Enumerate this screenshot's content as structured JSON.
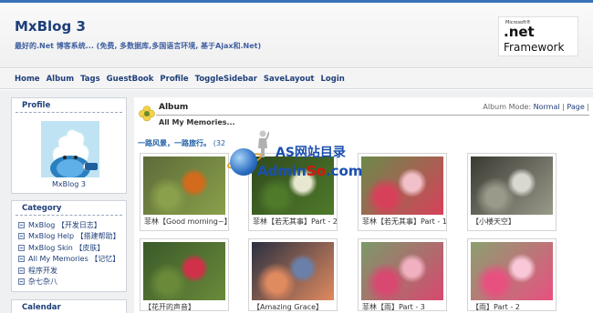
{
  "header": {
    "title": "MxBlog 3",
    "tagline": "最好的.Net 博客系统... (免费, 多数据库,多国语言环境, 基于Ajax和.Net)",
    "logo": {
      "small": "Microsoft®",
      "net": ".net",
      "framework": "Framework"
    }
  },
  "nav": [
    "Home",
    "Album",
    "Tags",
    "GuestBook",
    "Profile",
    "ToggleSidebar",
    "SaveLayout",
    "Login"
  ],
  "sidebar": {
    "profile": {
      "title": "Profile",
      "name": "MxBlog 3"
    },
    "category": {
      "title": "Category",
      "items": [
        "MxBlog 【开发日志】",
        "MxBlog Help 【搭建帮助】",
        "MxBlog Skin 【皮肤】",
        "All My Memories 【记忆】",
        "程序开发",
        "杂七杂八"
      ]
    },
    "calendar": {
      "title": "Calendar"
    }
  },
  "main": {
    "title": "Album",
    "subtitle": "All My Memories...",
    "mode_label": "Album Mode:",
    "mode_normal": "Normal",
    "mode_sep": "|",
    "mode_page": "Page",
    "mode_trail": "|",
    "desc": "一路风景，一路旅行。",
    "count": "(32"
  },
  "photos": [
    {
      "caption": "菲林【Good morning~】",
      "colors": [
        "#5c6b3a",
        "#8aa04a",
        "#d46a1c"
      ]
    },
    {
      "caption": "菲林【若无其事】Part - 2",
      "colors": [
        "#2f4a1e",
        "#4f7a2a",
        "#e8e8d0"
      ]
    },
    {
      "caption": "菲林【若无其事】Part - 1",
      "colors": [
        "#6a8a4a",
        "#d8405a",
        "#f2c0c8"
      ]
    },
    {
      "caption": "【小楼天空】",
      "colors": [
        "#3a3a34",
        "#9a9a8a",
        "#d8d8d0"
      ]
    },
    {
      "caption": "【花开的声音】",
      "colors": [
        "#3a5a2a",
        "#6a8a3a",
        "#d03048"
      ]
    },
    {
      "caption": "【Amazing Grace】",
      "colors": [
        "#2a3040",
        "#e08a60",
        "#6a80a8"
      ]
    },
    {
      "caption": "菲林【雨】Part - 3",
      "colors": [
        "#7a9a6a",
        "#d84870",
        "#f0b0c0"
      ]
    },
    {
      "caption": "【雨】Part - 2",
      "colors": [
        "#8aa070",
        "#e85080",
        "#f8c8d8"
      ]
    }
  ],
  "watermark": {
    "line1": "AS网站目录",
    "line2a": "Admin",
    "line2b": "So",
    "line2c": ".com"
  }
}
